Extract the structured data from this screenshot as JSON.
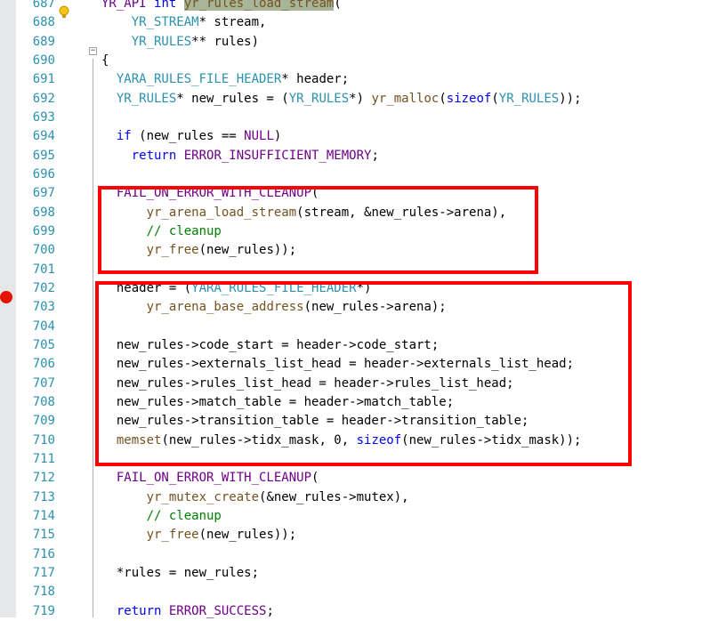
{
  "editor": {
    "colors": {
      "gutter_bg": "#e6e7e8",
      "line_number": "#2b91af",
      "macro": "#6f008a",
      "keyword": "#0000ff",
      "type": "#2b91af",
      "function": "#74531f",
      "comment": "#008000",
      "reference_highlight": "#a8b598",
      "breakpoint": "#e51400",
      "annotation_box": "#ff0000"
    },
    "icons": {
      "lightbulb": "lightbulb-icon",
      "breakpoint": "breakpoint-icon",
      "collapse": "collapse-icon"
    },
    "collapse_glyph": "−",
    "lines": [
      {
        "num": "687",
        "tokens": [
          {
            "t": "YR_API",
            "c": "macro"
          },
          {
            "t": " "
          },
          {
            "t": "int",
            "c": "kw"
          },
          {
            "t": " "
          },
          {
            "t": "yr_rules_load_stream",
            "c": "hl"
          },
          {
            "t": "("
          }
        ]
      },
      {
        "num": "688",
        "tokens": [
          {
            "t": "    "
          },
          {
            "t": "YR_STREAM",
            "c": "type"
          },
          {
            "t": "* stream,"
          }
        ]
      },
      {
        "num": "689",
        "tokens": [
          {
            "t": "    "
          },
          {
            "t": "YR_RULES",
            "c": "type"
          },
          {
            "t": "** rules)"
          }
        ]
      },
      {
        "num": "690",
        "tokens": [
          {
            "t": "{"
          }
        ]
      },
      {
        "num": "691",
        "tokens": [
          {
            "t": "  "
          },
          {
            "t": "YARA_RULES_FILE_HEADER",
            "c": "type"
          },
          {
            "t": "* header;"
          }
        ]
      },
      {
        "num": "692",
        "tokens": [
          {
            "t": "  "
          },
          {
            "t": "YR_RULES",
            "c": "type"
          },
          {
            "t": "* new_rules = ("
          },
          {
            "t": "YR_RULES",
            "c": "type"
          },
          {
            "t": "*) "
          },
          {
            "t": "yr_malloc",
            "c": "fn"
          },
          {
            "t": "("
          },
          {
            "t": "sizeof",
            "c": "kw"
          },
          {
            "t": "("
          },
          {
            "t": "YR_RULES",
            "c": "type"
          },
          {
            "t": "));"
          }
        ]
      },
      {
        "num": "693",
        "tokens": []
      },
      {
        "num": "694",
        "tokens": [
          {
            "t": "  "
          },
          {
            "t": "if",
            "c": "kw"
          },
          {
            "t": " (new_rules == "
          },
          {
            "t": "NULL",
            "c": "macro"
          },
          {
            "t": ")"
          }
        ]
      },
      {
        "num": "695",
        "tokens": [
          {
            "t": "    "
          },
          {
            "t": "return",
            "c": "kw"
          },
          {
            "t": " "
          },
          {
            "t": "ERROR_INSUFFICIENT_MEMORY",
            "c": "macro"
          },
          {
            "t": ";"
          }
        ]
      },
      {
        "num": "696",
        "tokens": []
      },
      {
        "num": "697",
        "tokens": [
          {
            "t": "  "
          },
          {
            "t": "FAIL_ON_ERROR_WITH_CLEANUP",
            "c": "macro"
          },
          {
            "t": "("
          }
        ]
      },
      {
        "num": "698",
        "tokens": [
          {
            "t": "      "
          },
          {
            "t": "yr_arena_load_stream",
            "c": "fn"
          },
          {
            "t": "(stream, &new_rules->arena),"
          }
        ]
      },
      {
        "num": "699",
        "tokens": [
          {
            "t": "      "
          },
          {
            "t": "// cleanup",
            "c": "cm"
          }
        ]
      },
      {
        "num": "700",
        "tokens": [
          {
            "t": "      "
          },
          {
            "t": "yr_free",
            "c": "fn"
          },
          {
            "t": "(new_rules));"
          }
        ]
      },
      {
        "num": "701",
        "tokens": []
      },
      {
        "num": "702",
        "tokens": [
          {
            "t": "  header = ("
          },
          {
            "t": "YARA_RULES_FILE_HEADER",
            "c": "type"
          },
          {
            "t": "*)"
          }
        ]
      },
      {
        "num": "703",
        "tokens": [
          {
            "t": "      "
          },
          {
            "t": "yr_arena_base_address",
            "c": "fn"
          },
          {
            "t": "(new_rules->arena);"
          }
        ]
      },
      {
        "num": "704",
        "tokens": []
      },
      {
        "num": "705",
        "tokens": [
          {
            "t": "  new_rules->code_start = header->code_start;"
          }
        ]
      },
      {
        "num": "706",
        "tokens": [
          {
            "t": "  new_rules->externals_list_head = header->externals_list_head;"
          }
        ]
      },
      {
        "num": "707",
        "tokens": [
          {
            "t": "  new_rules->rules_list_head = header->rules_list_head;"
          }
        ]
      },
      {
        "num": "708",
        "tokens": [
          {
            "t": "  new_rules->match_table = header->match_table;"
          }
        ]
      },
      {
        "num": "709",
        "tokens": [
          {
            "t": "  new_rules->transition_table = header->transition_table;"
          }
        ]
      },
      {
        "num": "710",
        "tokens": [
          {
            "t": "  "
          },
          {
            "t": "memset",
            "c": "fn"
          },
          {
            "t": "(new_rules->tidx_mask, 0, "
          },
          {
            "t": "sizeof",
            "c": "kw"
          },
          {
            "t": "(new_rules->tidx_mask));"
          }
        ]
      },
      {
        "num": "711",
        "tokens": []
      },
      {
        "num": "712",
        "tokens": [
          {
            "t": "  "
          },
          {
            "t": "FAIL_ON_ERROR_WITH_CLEANUP",
            "c": "macro"
          },
          {
            "t": "("
          }
        ]
      },
      {
        "num": "713",
        "tokens": [
          {
            "t": "      "
          },
          {
            "t": "yr_mutex_create",
            "c": "fn"
          },
          {
            "t": "(&new_rules->mutex),"
          }
        ]
      },
      {
        "num": "714",
        "tokens": [
          {
            "t": "      "
          },
          {
            "t": "// cleanup",
            "c": "cm"
          }
        ]
      },
      {
        "num": "715",
        "tokens": [
          {
            "t": "      "
          },
          {
            "t": "yr_free",
            "c": "fn"
          },
          {
            "t": "(new_rules));"
          }
        ]
      },
      {
        "num": "716",
        "tokens": []
      },
      {
        "num": "717",
        "tokens": [
          {
            "t": "  *rules = new_rules;"
          }
        ]
      },
      {
        "num": "718",
        "tokens": []
      },
      {
        "num": "719",
        "tokens": [
          {
            "t": "  "
          },
          {
            "t": "return",
            "c": "kw"
          },
          {
            "t": " "
          },
          {
            "t": "ERROR_SUCCESS",
            "c": "macro"
          },
          {
            "t": ";"
          }
        ]
      }
    ]
  }
}
